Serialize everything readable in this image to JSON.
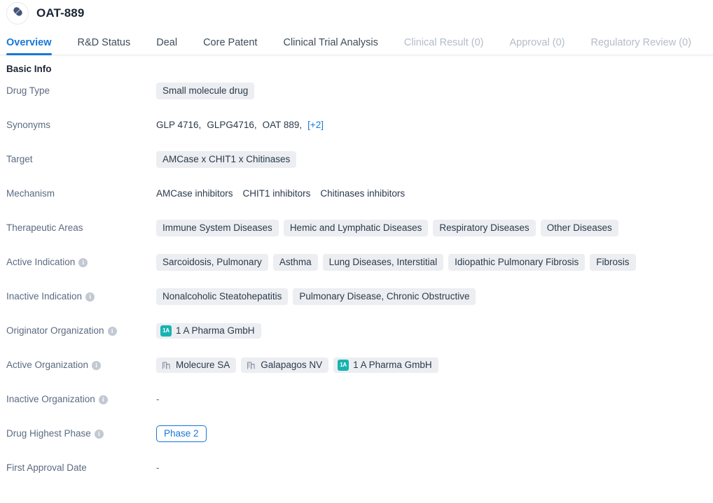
{
  "header": {
    "title": "OAT-889",
    "avatar_icon": "pill-capsule-icon"
  },
  "tabs": [
    {
      "label": "Overview",
      "state": "active"
    },
    {
      "label": "R&D Status",
      "state": "normal"
    },
    {
      "label": "Deal",
      "state": "normal"
    },
    {
      "label": "Core Patent",
      "state": "normal"
    },
    {
      "label": "Clinical Trial Analysis",
      "state": "normal"
    },
    {
      "label": "Clinical Result (0)",
      "state": "disabled"
    },
    {
      "label": "Approval (0)",
      "state": "disabled"
    },
    {
      "label": "Regulatory Review (0)",
      "state": "disabled"
    }
  ],
  "section": {
    "title": "Basic Info"
  },
  "rows": {
    "drug_type": {
      "label": "Drug Type",
      "tags": [
        "Small molecule drug"
      ]
    },
    "synonyms": {
      "label": "Synonyms",
      "items": [
        "GLP 4716,",
        "GLPG4716,",
        "OAT 889,"
      ],
      "more": "[+2]"
    },
    "target": {
      "label": "Target",
      "tags": [
        "AMCase x CHIT1 x Chitinases"
      ]
    },
    "mechanism": {
      "label": "Mechanism",
      "items": [
        "AMCase inhibitors",
        "CHIT1 inhibitors",
        "Chitinases inhibitors"
      ]
    },
    "therapeutic_areas": {
      "label": "Therapeutic Areas",
      "tags": [
        "Immune System Diseases",
        "Hemic and Lymphatic Diseases",
        "Respiratory Diseases",
        "Other Diseases"
      ]
    },
    "active_indication": {
      "label": "Active Indication",
      "has_info": true,
      "tags": [
        "Sarcoidosis, Pulmonary",
        "Asthma",
        "Lung Diseases, Interstitial",
        "Idiopathic Pulmonary Fibrosis",
        "Fibrosis"
      ]
    },
    "inactive_indication": {
      "label": "Inactive Indication",
      "has_info": true,
      "tags": [
        "Nonalcoholic Steatohepatitis",
        "Pulmonary Disease, Chronic Obstructive"
      ]
    },
    "originator_organization": {
      "label": "Originator Organization",
      "has_info": true,
      "orgs": [
        {
          "name": "1 A Pharma GmbH",
          "icon": "company-logo-1a",
          "logo_text": "1A"
        }
      ]
    },
    "active_organization": {
      "label": "Active Organization",
      "has_info": true,
      "orgs": [
        {
          "name": "Molecure SA",
          "icon": "building-icon"
        },
        {
          "name": "Galapagos NV",
          "icon": "building-icon"
        },
        {
          "name": "1 A Pharma GmbH",
          "icon": "company-logo-1a",
          "logo_text": "1A"
        }
      ]
    },
    "inactive_organization": {
      "label": "Inactive Organization",
      "has_info": true,
      "empty_value": "-"
    },
    "drug_highest_phase": {
      "label": "Drug Highest Phase",
      "has_info": true,
      "phase": "Phase 2"
    },
    "first_approval_date": {
      "label": "First Approval Date",
      "empty_value": "-"
    }
  },
  "colors": {
    "accent_blue": "#1677d6",
    "tag_bg": "#eceef2",
    "label_gray": "#5b6b80",
    "teal_logo": "#17b3b0",
    "disabled_tab": "#b3bcc8"
  }
}
